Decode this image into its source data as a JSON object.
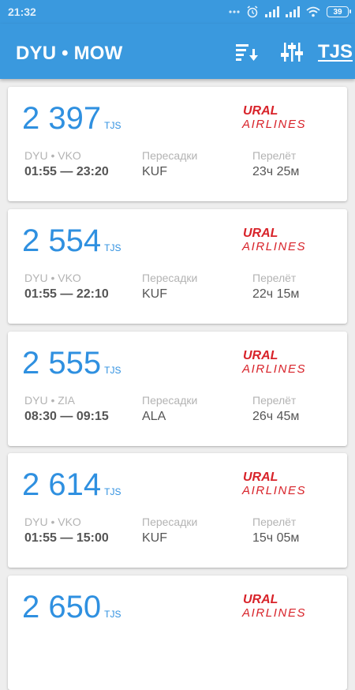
{
  "status_bar": {
    "time": "21:32",
    "battery": "39"
  },
  "app_bar": {
    "route": "DYU • MOW",
    "currency": "TJS"
  },
  "icons": {
    "sort": "sort-icon",
    "filter": "filter-icon"
  },
  "colors": {
    "primary": "#3a99de",
    "price": "#2f90e0",
    "logo_red": "#d8232a"
  },
  "cards": [
    {
      "price": "2 397",
      "currency": "TJS",
      "airline": {
        "line1": "URAL",
        "line2": "AIRLINES"
      },
      "route_label": "DYU • VKO",
      "time": "01:55 — 23:20",
      "transfers_label": "Пересадки",
      "transfers": "KUF",
      "duration_label": "Перелёт",
      "duration": "23ч 25м"
    },
    {
      "price": "2 554",
      "currency": "TJS",
      "airline": {
        "line1": "URAL",
        "line2": "AIRLINES"
      },
      "route_label": "DYU • VKO",
      "time": "01:55 — 22:10",
      "transfers_label": "Пересадки",
      "transfers": "KUF",
      "duration_label": "Перелёт",
      "duration": "22ч 15м"
    },
    {
      "price": "2 555",
      "currency": "TJS",
      "airline": {
        "line1": "URAL",
        "line2": "AIRLINES"
      },
      "route_label": "DYU • ZIA",
      "time": "08:30 — 09:15",
      "transfers_label": "Пересадки",
      "transfers": "ALA",
      "duration_label": "Перелёт",
      "duration": "26ч 45м"
    },
    {
      "price": "2 614",
      "currency": "TJS",
      "airline": {
        "line1": "URAL",
        "line2": "AIRLINES"
      },
      "route_label": "DYU • VKO",
      "time": "01:55 — 15:00",
      "transfers_label": "Пересадки",
      "transfers": "KUF",
      "duration_label": "Перелёт",
      "duration": "15ч 05м"
    },
    {
      "price": "2 650",
      "currency": "TJS",
      "airline": {
        "line1": "URAL",
        "line2": "AIRLINES"
      },
      "route_label": "",
      "time": "",
      "transfers_label": "",
      "transfers": "",
      "duration_label": "",
      "duration": ""
    }
  ]
}
